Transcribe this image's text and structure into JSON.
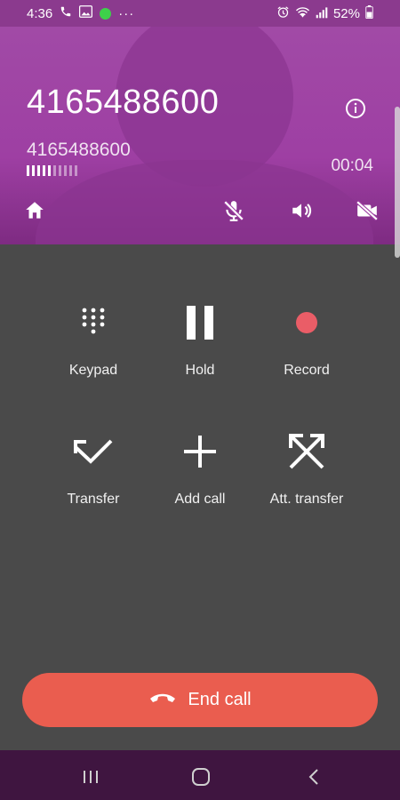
{
  "status": {
    "time": "4:36",
    "battery": "52%"
  },
  "call": {
    "number_primary": "4165488600",
    "number_secondary": "4165488600",
    "duration": "00:04"
  },
  "actions": [
    {
      "label": "Keypad",
      "icon": "keypad-icon"
    },
    {
      "label": "Hold",
      "icon": "pause-icon"
    },
    {
      "label": "Record",
      "icon": "record-icon"
    },
    {
      "label": "Transfer",
      "icon": "transfer-icon"
    },
    {
      "label": "Add call",
      "icon": "plus-icon"
    },
    {
      "label": "Att. transfer",
      "icon": "attended-transfer-icon"
    }
  ],
  "end_call": {
    "label": "End call"
  },
  "colors": {
    "header": "#9e3fa3",
    "status_bar": "#8b3a8e",
    "panel": "#4a4a4a",
    "end_call": "#ea5d4f",
    "record": "#ea5d67",
    "nav_bar": "#3f1540"
  }
}
